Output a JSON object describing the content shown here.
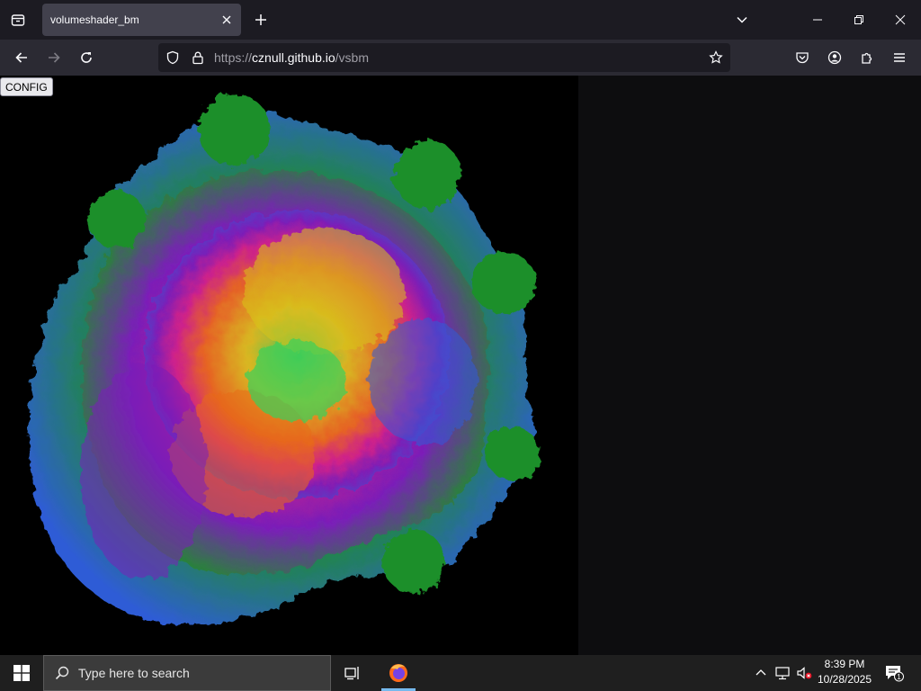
{
  "browser": {
    "tab": {
      "title": "volumeshader_bm"
    },
    "url": {
      "scheme": "https://",
      "host": "cznull.github.io",
      "path": "/vsbm"
    }
  },
  "page": {
    "config_button": "CONFIG",
    "fractal_colors": [
      "#1e8f2a",
      "#2f5cd6",
      "#7a1fb8",
      "#d0208a",
      "#e86a1a",
      "#d8c21c",
      "#3ad05a"
    ]
  },
  "taskbar": {
    "search_placeholder": "Type here to search",
    "time": "8:39 PM",
    "date": "10/28/2025",
    "notification_count": "1"
  },
  "colors": {
    "tabbar_bg": "#1c1b22",
    "navbar_bg": "#2b2a33",
    "urlbar_bg": "#1c1b22",
    "active_tab_bg": "#42414d",
    "taskbar_bg": "#1f1f1f",
    "accent": "#76b9ed"
  }
}
